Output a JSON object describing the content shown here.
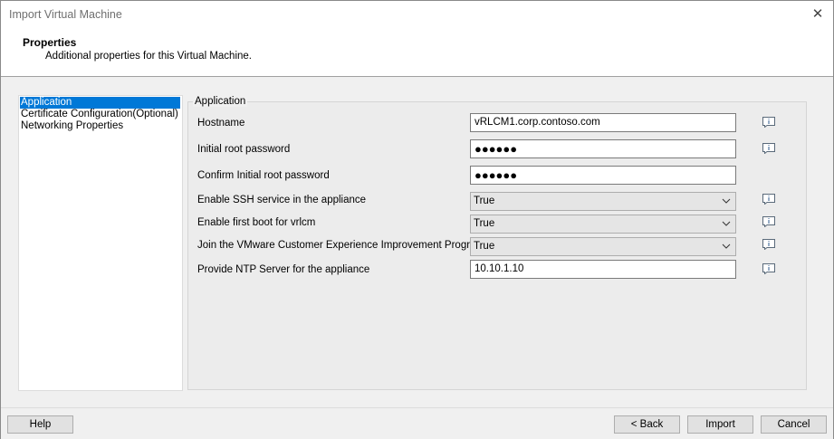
{
  "window": {
    "title": "Import Virtual Machine",
    "close": "✕"
  },
  "header": {
    "title": "Properties",
    "subtitle": "Additional properties for this Virtual Machine."
  },
  "nav": [
    {
      "label": "Application",
      "selected": true
    },
    {
      "label": "Certificate Configuration(Optional)",
      "selected": false
    },
    {
      "label": "Networking Properties",
      "selected": false
    }
  ],
  "group": {
    "title": "Application"
  },
  "fields": {
    "hostname": {
      "label": "Hostname",
      "value": "vRLCM1.corp.contoso.com"
    },
    "root_password": {
      "label": "Initial root password",
      "value": "●●●●●●"
    },
    "confirm_password": {
      "label": "Confirm Initial root password",
      "value": "●●●●●●"
    },
    "ssh": {
      "label": "Enable SSH service in the appliance",
      "value": "True"
    },
    "first_boot": {
      "label": "Enable first boot for vrlcm",
      "value": "True"
    },
    "ceip": {
      "label": "Join the VMware Customer Experience Improvement Program",
      "value": "True"
    },
    "ntp": {
      "label": "Provide NTP Server for the appliance",
      "value": "10.10.1.10"
    }
  },
  "buttons": {
    "help": "Help",
    "back": "< Back",
    "import": "Import",
    "cancel": "Cancel"
  },
  "icons": {
    "info": "info-icon",
    "dropdown": "chevron-down-icon",
    "close": "close-icon"
  }
}
